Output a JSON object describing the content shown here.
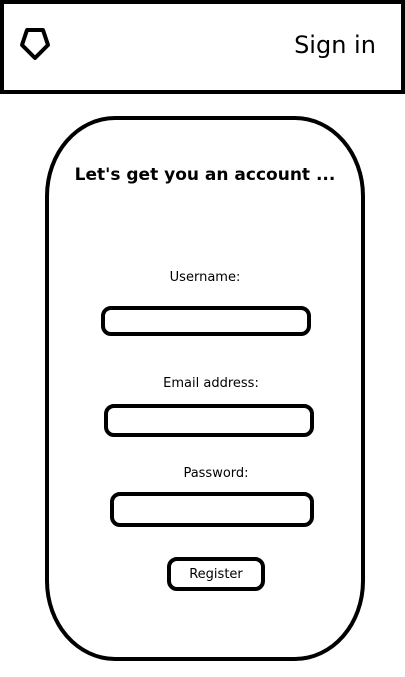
{
  "header": {
    "logo_icon": "pentagon-logo-icon",
    "signin_label": "Sign in"
  },
  "form": {
    "title": "Let's get you an account ...",
    "username_label": "Username:",
    "username_value": "",
    "email_label": "Email address:",
    "email_value": "",
    "password_label": "Password:",
    "password_value": "",
    "register_label": "Register"
  }
}
